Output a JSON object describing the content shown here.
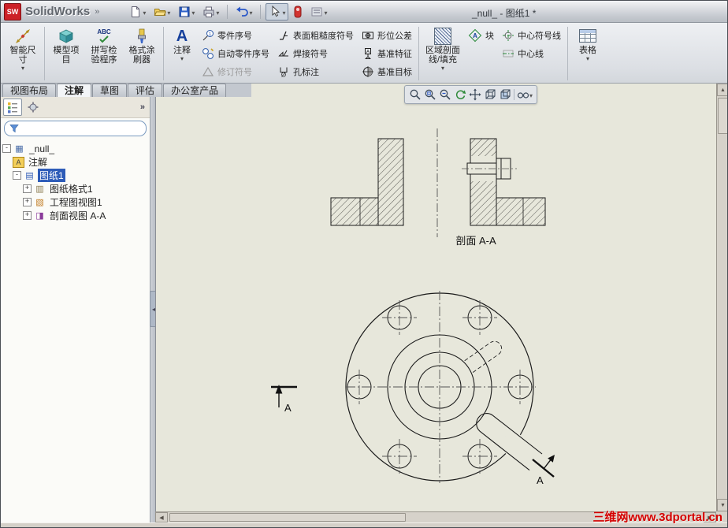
{
  "window": {
    "brand": "SolidWorks",
    "title": "_null_ - 图纸1 *"
  },
  "titlebar_icons": [
    "new-document",
    "open",
    "save",
    "print",
    "undo",
    "select",
    "rebuild",
    "options"
  ],
  "ribbon": {
    "big": [
      {
        "label": "智能尺寸",
        "caret": "▾"
      },
      {
        "label": "模型项目"
      },
      {
        "label": "拼写检验程序",
        "badge": "ABC"
      },
      {
        "label": "格式涂刷器"
      },
      {
        "label": "注释",
        "caret": "▾"
      }
    ],
    "cols": [
      {
        "items": [
          {
            "label": "零件序号"
          },
          {
            "label": "自动零件序号"
          },
          {
            "label": "修订符号",
            "disabled": true
          }
        ]
      },
      {
        "items": [
          {
            "label": "表面粗糙度符号"
          },
          {
            "label": "焊接符号"
          },
          {
            "label": "孔标注"
          }
        ]
      },
      {
        "items": [
          {
            "label": "形位公差"
          },
          {
            "label": "基准特征"
          },
          {
            "label": "基准目标"
          }
        ]
      }
    ],
    "hatch": {
      "label": "区域剖面线/填充",
      "caret": "▾"
    },
    "block": {
      "label": "块"
    },
    "center_col": {
      "items": [
        {
          "label": "中心符号线"
        },
        {
          "label": "中心线"
        }
      ]
    },
    "table": {
      "label": "表格",
      "caret": "▾"
    }
  },
  "command_tabs": [
    {
      "label": "视图布局",
      "active": false
    },
    {
      "label": "注解",
      "active": true
    },
    {
      "label": "草图",
      "active": false
    },
    {
      "label": "评估",
      "active": false
    },
    {
      "label": "办公室产品",
      "active": false
    }
  ],
  "view_toolbar_icons": [
    "zoom-fit",
    "zoom-area",
    "zoom-previous",
    "rotate-view",
    "pan",
    "view-orientation",
    "display-style",
    "view-settings"
  ],
  "feature_tree": {
    "filter_value": "",
    "overflow_icon": "»",
    "items": [
      {
        "label": "_null_",
        "expander": "-",
        "selected": false
      },
      {
        "label": "注解",
        "expander": "",
        "selected": false
      },
      {
        "label": "图纸1",
        "expander": "-",
        "selected": true
      },
      {
        "label": "图纸格式1",
        "expander": "+",
        "selected": false
      },
      {
        "label": "工程图视图1",
        "expander": "+",
        "selected": false
      },
      {
        "label": "剖面视图 A-A",
        "expander": "+",
        "selected": false
      }
    ]
  },
  "drawing": {
    "section_label": "剖面 A-A",
    "section_arrow_left": "A",
    "section_arrow_right": "A"
  },
  "watermark": {
    "text": "三维网www.3dportal.cn",
    "color": "#d40000"
  },
  "colors": {
    "selection": "#2e5cb8",
    "sheet": "#e7e7db",
    "logo_red": "#cc2128"
  }
}
